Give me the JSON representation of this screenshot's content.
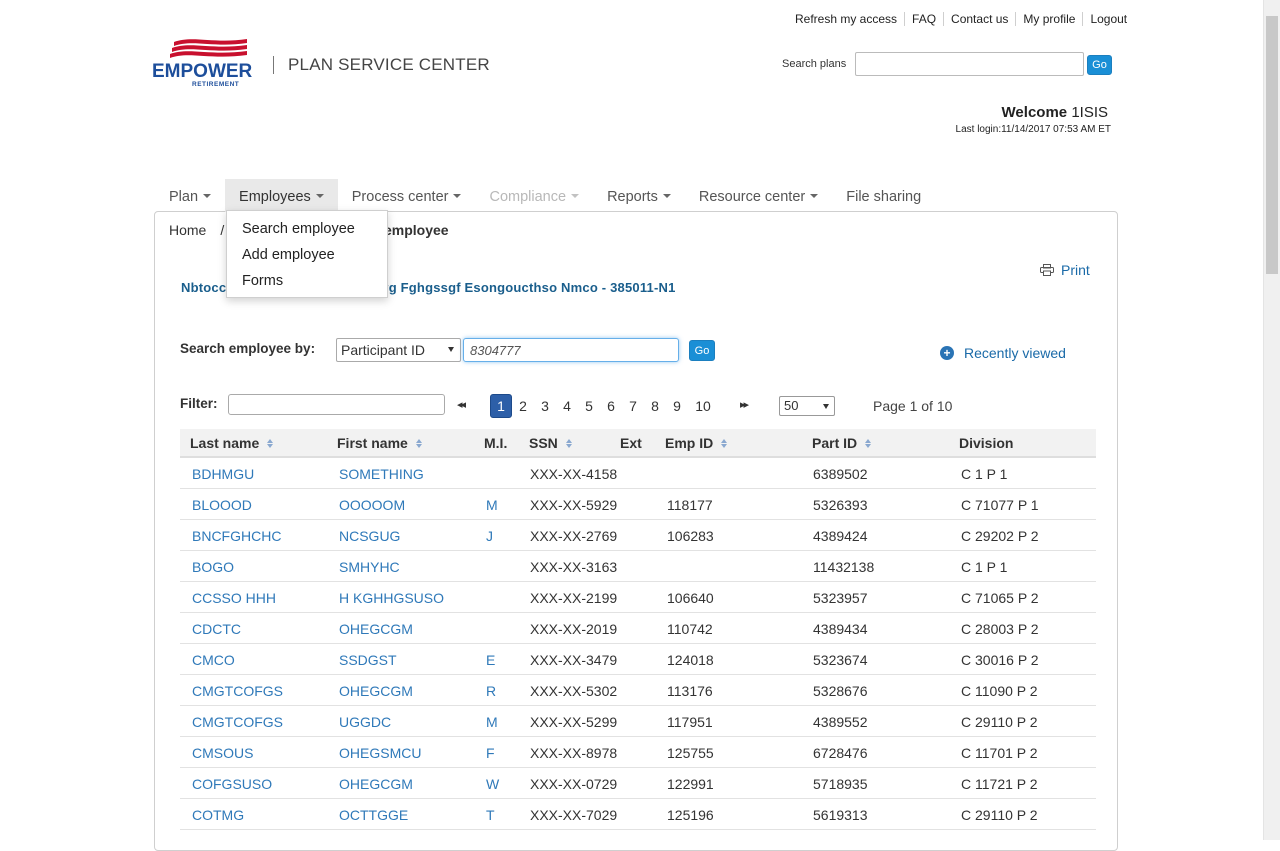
{
  "top_links": [
    "Refresh my access",
    "FAQ",
    "Contact us",
    "My profile",
    "Logout"
  ],
  "brand": {
    "logo_word": "EMPOWER",
    "logo_sub": "RETIREMENT",
    "app_title": "PLAN SERVICE CENTER"
  },
  "search_plans": {
    "label": "Search plans",
    "value": "",
    "button": "Go"
  },
  "welcome": {
    "prefix": "Welcome",
    "user": "1ISIS",
    "last_login": "Last login:11/14/2017 07:53 AM ET"
  },
  "nav": [
    {
      "label": "Plan"
    },
    {
      "label": "Employees"
    },
    {
      "label": "Process center"
    },
    {
      "label": "Compliance"
    },
    {
      "label": "Reports"
    },
    {
      "label": "Resource center"
    },
    {
      "label": "File sharing"
    }
  ],
  "dropdown": [
    "Search employee",
    "Add employee",
    "Forms"
  ],
  "breadcrumb": {
    "home": "Home",
    "separator": "/",
    "current": "employee"
  },
  "print_label": "Print",
  "plan_heading": {
    "left": "Nbtocc",
    "right": "yg Fghgssgf Esongoucthso Nmco - 385011-N1"
  },
  "search_by": {
    "label": "Search employee by:",
    "selected": "Participant ID",
    "value": "8304777",
    "button": "Go"
  },
  "recently_viewed": "Recently viewed",
  "filter": {
    "label": "Filter:",
    "value": ""
  },
  "pagination": {
    "prev": "◂◂",
    "next": "▸▸",
    "pages": [
      "1",
      "2",
      "3",
      "4",
      "5",
      "6",
      "7",
      "8",
      "9",
      "10"
    ],
    "current": "1",
    "per_page": "50",
    "page_of": "Page 1 of 10"
  },
  "table": {
    "headers": [
      "Last name",
      "First name",
      "M.I.",
      "SSN",
      "Ext",
      "Emp ID",
      "Part ID",
      "Division"
    ],
    "rows": [
      [
        "BDHMGU",
        "SOMETHING",
        "",
        "XXX-XX-4158",
        "",
        "",
        "6389502",
        "C 1 P 1"
      ],
      [
        "BLOOOD",
        "OOOOOM",
        "M",
        "XXX-XX-5929",
        "",
        "118177",
        "5326393",
        "C 71077 P 1"
      ],
      [
        "BNCFGHCHC",
        "NCSGUG",
        "J",
        "XXX-XX-2769",
        "",
        "106283",
        "4389424",
        "C 29202 P 2"
      ],
      [
        "BOGO",
        "SMHYHC",
        "",
        "XXX-XX-3163",
        "",
        "",
        "11432138",
        "C 1 P 1"
      ],
      [
        "CCSSO HHH",
        "H KGHHGSUSO",
        "",
        "XXX-XX-2199",
        "",
        "106640",
        "5323957",
        "C 71065 P 2"
      ],
      [
        "CDCTC",
        "OHEGCGM",
        "",
        "XXX-XX-2019",
        "",
        "110742",
        "4389434",
        "C 28003 P 2"
      ],
      [
        "CMCO",
        "SSDGST",
        "E",
        "XXX-XX-3479",
        "",
        "124018",
        "5323674",
        "C 30016 P 2"
      ],
      [
        "CMGTCOFGS",
        "OHEGCGM",
        "R",
        "XXX-XX-5302",
        "",
        "113176",
        "5328676",
        "C 11090 P 2"
      ],
      [
        "CMGTCOFGS",
        "UGGDC",
        "M",
        "XXX-XX-5299",
        "",
        "117951",
        "4389552",
        "C 29110 P 2"
      ],
      [
        "CMSOUS",
        "OHEGSMCU",
        "F",
        "XXX-XX-8978",
        "",
        "125755",
        "6728476",
        "C 11701 P 2"
      ],
      [
        "COFGSUSO",
        "OHEGCGM",
        "W",
        "XXX-XX-0729",
        "",
        "122991",
        "5718935",
        "C 11721 P 2"
      ],
      [
        "COTMG",
        "OCTTGGE",
        "T",
        "XXX-XX-7029",
        "",
        "125196",
        "5619313",
        "C 29110 P 2"
      ]
    ]
  }
}
